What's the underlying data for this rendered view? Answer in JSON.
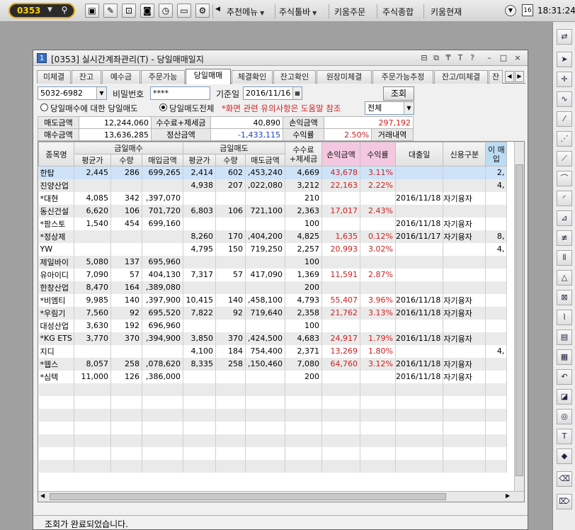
{
  "top": {
    "code": "0353",
    "menus": [
      "추천메뉴",
      "주식툴바",
      "키움주문",
      "주식종합",
      "키움현재"
    ],
    "time": "18:31:24",
    "cal": "16"
  },
  "window": {
    "num": "1",
    "title": "[0353] 실시간계좌관리(T) - 당일매매일지",
    "controls": [
      "⊟",
      "⧉",
      "₸",
      "T",
      "?",
      "–",
      "□",
      "×"
    ]
  },
  "tabs": [
    "미체결",
    "잔고",
    "예수금",
    "주문가능",
    "당일매매",
    "체결확인",
    "잔고확인",
    "원장미체결",
    "주문가능추정",
    "잔고/미체결",
    "잔"
  ],
  "form": {
    "account": "5032-6982",
    "pw_label": "비밀번호",
    "pw": "****",
    "date_label": "기준일",
    "date": "2016/11/16",
    "query": "조회",
    "radio1": "당일매수에 대한 당일매도",
    "radio2": "당일매도전체",
    "notice": "*화면 관련 유의사항은 도움말 참조",
    "filter": "전체"
  },
  "summary": {
    "r1": [
      "매도금액",
      "12,244,060",
      "수수료+제세금",
      "40,890",
      "손익금액",
      "297,192"
    ],
    "r2": [
      "매수금액",
      "13,636,285",
      "정산금액",
      "-1,433,115",
      "수익률",
      "2.50%",
      "거래내역"
    ]
  },
  "grid": {
    "h1": [
      "종목명",
      "금일매수",
      "금일매도",
      "수수료 +제세금",
      "손익금액",
      "수익률",
      "대출일",
      "신용구분",
      "이 매입"
    ],
    "h2": [
      "평균가",
      "수량",
      "매입금액",
      "평균가",
      "수량",
      "매도금액"
    ],
    "rows": [
      [
        "한탑",
        "2,445",
        "286",
        "699,265",
        "2,414",
        "602",
        ",453,240",
        "4,669",
        "43,678",
        "3.11%",
        "",
        "",
        "2,"
      ],
      [
        "진양산업",
        "",
        "",
        "",
        "4,938",
        "207",
        ",022,080",
        "3,212",
        "22,163",
        "2.22%",
        "",
        "",
        "4,"
      ],
      [
        "*대현",
        "4,085",
        "342",
        ",397,070",
        "",
        "",
        "",
        "210",
        "",
        "",
        "2016/11/18",
        "자기융자",
        ""
      ],
      [
        "동신건설",
        "6,620",
        "106",
        "701,720",
        "6,803",
        "106",
        "721,100",
        "2,363",
        "17,017",
        "2.43%",
        "",
        "",
        ""
      ],
      [
        "*팜스토",
        "1,540",
        "454",
        "699,160",
        "",
        "",
        "",
        "100",
        "",
        "",
        "2016/11/18",
        "자기융자",
        ""
      ],
      [
        "*정상제",
        "",
        "",
        "",
        "8,260",
        "170",
        ",404,200",
        "4,825",
        "1,635",
        "0.12%",
        "2016/11/17",
        "자기융자",
        "8,"
      ],
      [
        "YW",
        "",
        "",
        "",
        "4,795",
        "150",
        "719,250",
        "2,257",
        "20,993",
        "3.02%",
        "",
        "",
        "4,"
      ],
      [
        "제일바이",
        "5,080",
        "137",
        "695,960",
        "",
        "",
        "",
        "100",
        "",
        "",
        "",
        "",
        ""
      ],
      [
        "유아이디",
        "7,090",
        "57",
        "404,130",
        "7,317",
        "57",
        "417,090",
        "1,369",
        "11,591",
        "2.87%",
        "",
        "",
        ""
      ],
      [
        "한창산업",
        "8,470",
        "164",
        ",389,080",
        "",
        "",
        "",
        "200",
        "",
        "",
        "",
        "",
        ""
      ],
      [
        "*비엠티",
        "9,985",
        "140",
        ",397,900",
        "10,415",
        "140",
        ",458,100",
        "4,793",
        "55,407",
        "3.96%",
        "2016/11/18",
        "자기융자",
        ""
      ],
      [
        "*우림기",
        "7,560",
        "92",
        "695,520",
        "7,822",
        "92",
        "719,640",
        "2,358",
        "21,762",
        "3.13%",
        "2016/11/18",
        "자기융자",
        ""
      ],
      [
        "대성산업",
        "3,630",
        "192",
        "696,960",
        "",
        "",
        "",
        "100",
        "",
        "",
        "",
        "",
        ""
      ],
      [
        "*KG ETS",
        "3,770",
        "370",
        ",394,900",
        "3,850",
        "370",
        ",424,500",
        "4,683",
        "24,917",
        "1.79%",
        "2016/11/18",
        "자기융자",
        ""
      ],
      [
        "지디",
        "",
        "",
        "",
        "4,100",
        "184",
        "754,400",
        "2,371",
        "13,269",
        "1.80%",
        "",
        "",
        "4,"
      ],
      [
        "*웹스",
        "8,057",
        "258",
        ",078,620",
        "8,335",
        "258",
        ",150,460",
        "7,080",
        "64,760",
        "3.12%",
        "2016/11/18",
        "자기융자",
        ""
      ],
      [
        "*심텍",
        "11,000",
        "126",
        ",386,000",
        "",
        "",
        "",
        "200",
        "",
        "",
        "2016/11/18",
        "자기융자",
        ""
      ]
    ]
  },
  "status": "조회가 완료되었습니다.",
  "colors": {
    "accent": "#3a6fc0",
    "profit": "#d02020",
    "pink_header": "#f4c8e0",
    "blue_header": "#bcdcf4"
  }
}
